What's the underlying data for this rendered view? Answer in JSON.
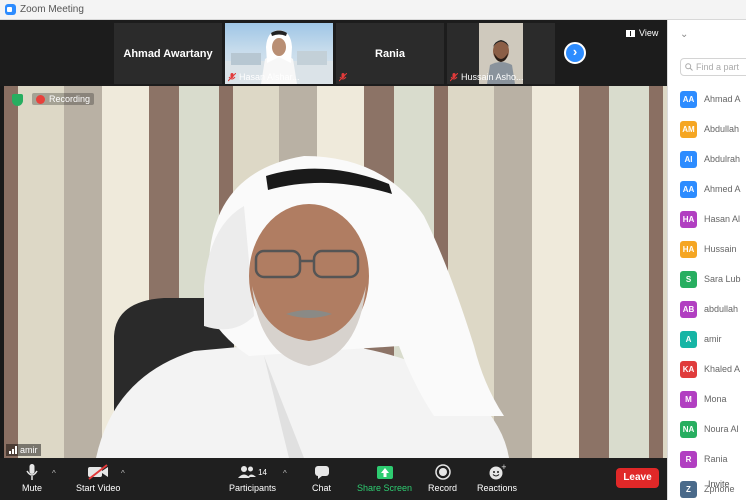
{
  "window": {
    "title": "Zoom Meeting"
  },
  "thumbnails": [
    {
      "name": "Ahmad Awartany"
    },
    {
      "caption": "Hasan Alshar..."
    },
    {
      "name": "Rania"
    },
    {
      "caption": "Hussain Asho..."
    }
  ],
  "view": {
    "label": "View"
  },
  "speaker": {
    "name": "amir",
    "recording_label": "Recording"
  },
  "controls": {
    "mute": "Mute",
    "start_video": "Start Video",
    "participants": "Participants",
    "participants_count": "14",
    "chat": "Chat",
    "share_screen": "Share Screen",
    "record": "Record",
    "reactions": "Reactions",
    "leave": "Leave"
  },
  "panel": {
    "search_placeholder": "Find a part",
    "participants": [
      {
        "initials": "AA",
        "name": "Ahmad A",
        "color": "#2d8cff"
      },
      {
        "initials": "AM",
        "name": "Abdullah",
        "color": "#f5a623"
      },
      {
        "initials": "AI",
        "name": "Abdulrah",
        "color": "#2d8cff"
      },
      {
        "initials": "AA",
        "name": "Ahmed A",
        "color": "#2d8cff"
      },
      {
        "initials": "HA",
        "name": "Hasan Al",
        "color": "#b13fc1"
      },
      {
        "initials": "HA",
        "name": "Hussain",
        "color": "#f5a623"
      },
      {
        "initials": "S",
        "name": "Sara Lub",
        "color": "#27ae60"
      },
      {
        "initials": "AB",
        "name": "abdullah",
        "color": "#b13fc1"
      },
      {
        "initials": "A",
        "name": "amir",
        "color": "#16b5a5"
      },
      {
        "initials": "KA",
        "name": "Khaled A",
        "color": "#e03c3c"
      },
      {
        "initials": "M",
        "name": "Mona",
        "color": "#b13fc1"
      },
      {
        "initials": "NA",
        "name": "Noura Al",
        "color": "#27ae60"
      },
      {
        "initials": "R",
        "name": "Rania",
        "color": "#b13fc1"
      },
      {
        "initials": "Z",
        "name": "Zphone",
        "color": "#4a6a8a"
      }
    ],
    "invite": "Invite"
  }
}
